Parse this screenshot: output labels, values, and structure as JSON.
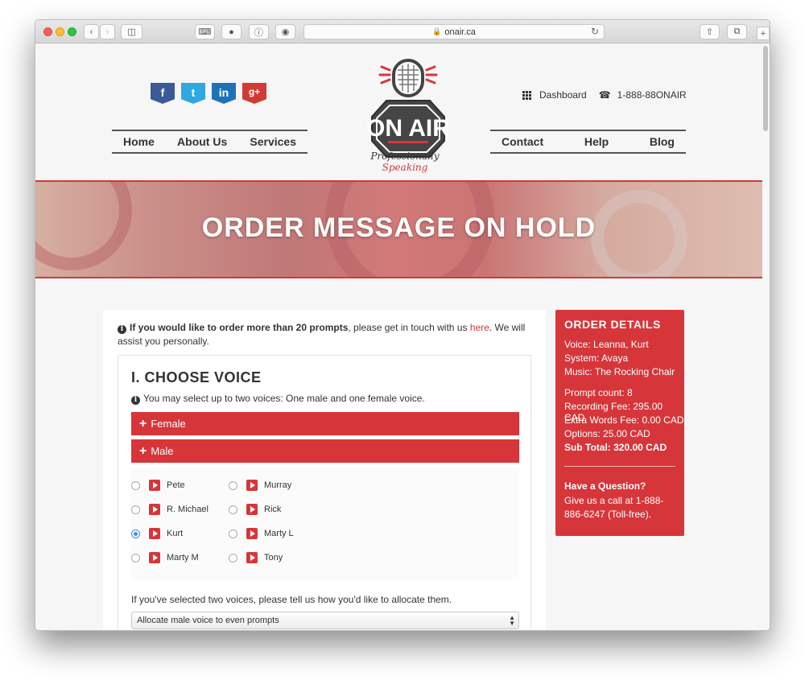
{
  "browser": {
    "url": "onair.ca"
  },
  "header": {
    "social": [
      "f",
      "t",
      "in",
      "g+"
    ],
    "dashboard_label": "Dashboard",
    "phone_label": "1-888-88ONAIR",
    "nav_left": [
      "Home",
      "About Us",
      "Services"
    ],
    "nav_right": [
      "Contact",
      "Help",
      "Blog"
    ],
    "logo_text": "ON AIR",
    "tagline_prefix": "Professionally",
    "tagline_accent": "Speaking"
  },
  "banner": {
    "title": "ORDER MESSAGE ON HOLD"
  },
  "notice": {
    "bold_text": "If you would like to order more than 20 prompts",
    "text_before_link": ", please get in touch with us ",
    "link_text": "here",
    "text_after_link": ". We will assist you personally."
  },
  "choose_voice": {
    "title": "I. CHOOSE VOICE",
    "hint": "You may select up to two voices: One male and one female voice.",
    "female_label": "Female",
    "male_label": "Male",
    "voices": [
      {
        "name": "Pete",
        "checked": false
      },
      {
        "name": "Murray",
        "checked": false
      },
      {
        "name": "R. Michael",
        "checked": false
      },
      {
        "name": "Rick",
        "checked": false
      },
      {
        "name": "Kurt",
        "checked": true
      },
      {
        "name": "Marty L",
        "checked": false
      },
      {
        "name": "Marty M",
        "checked": false
      },
      {
        "name": "Tony",
        "checked": false
      }
    ],
    "allocation_question": "If you've selected two voices, please tell us how you'd like to allocate them.",
    "allocation_value": "Allocate male voice to even prompts"
  },
  "order_details": {
    "title": "ORDER DETAILS",
    "voice": "Voice: Leanna, Kurt",
    "system": "System: Avaya",
    "music": "Music: The Rocking Chair",
    "prompt_count": "Prompt count: 8",
    "recording_fee": "Recording Fee: 295.00 CAD",
    "extra_words_fee": "Extra Words Fee: 0.00 CAD",
    "options": "Options: 25.00 CAD",
    "sub_total": "Sub Total: 320.00 CAD",
    "question_title": "Have a Question?",
    "call_text": "Give us a call at 1-888-886-6247 (Toll-free)."
  },
  "colors": {
    "brand_red": "#d6363a",
    "text_dark": "#333333"
  }
}
